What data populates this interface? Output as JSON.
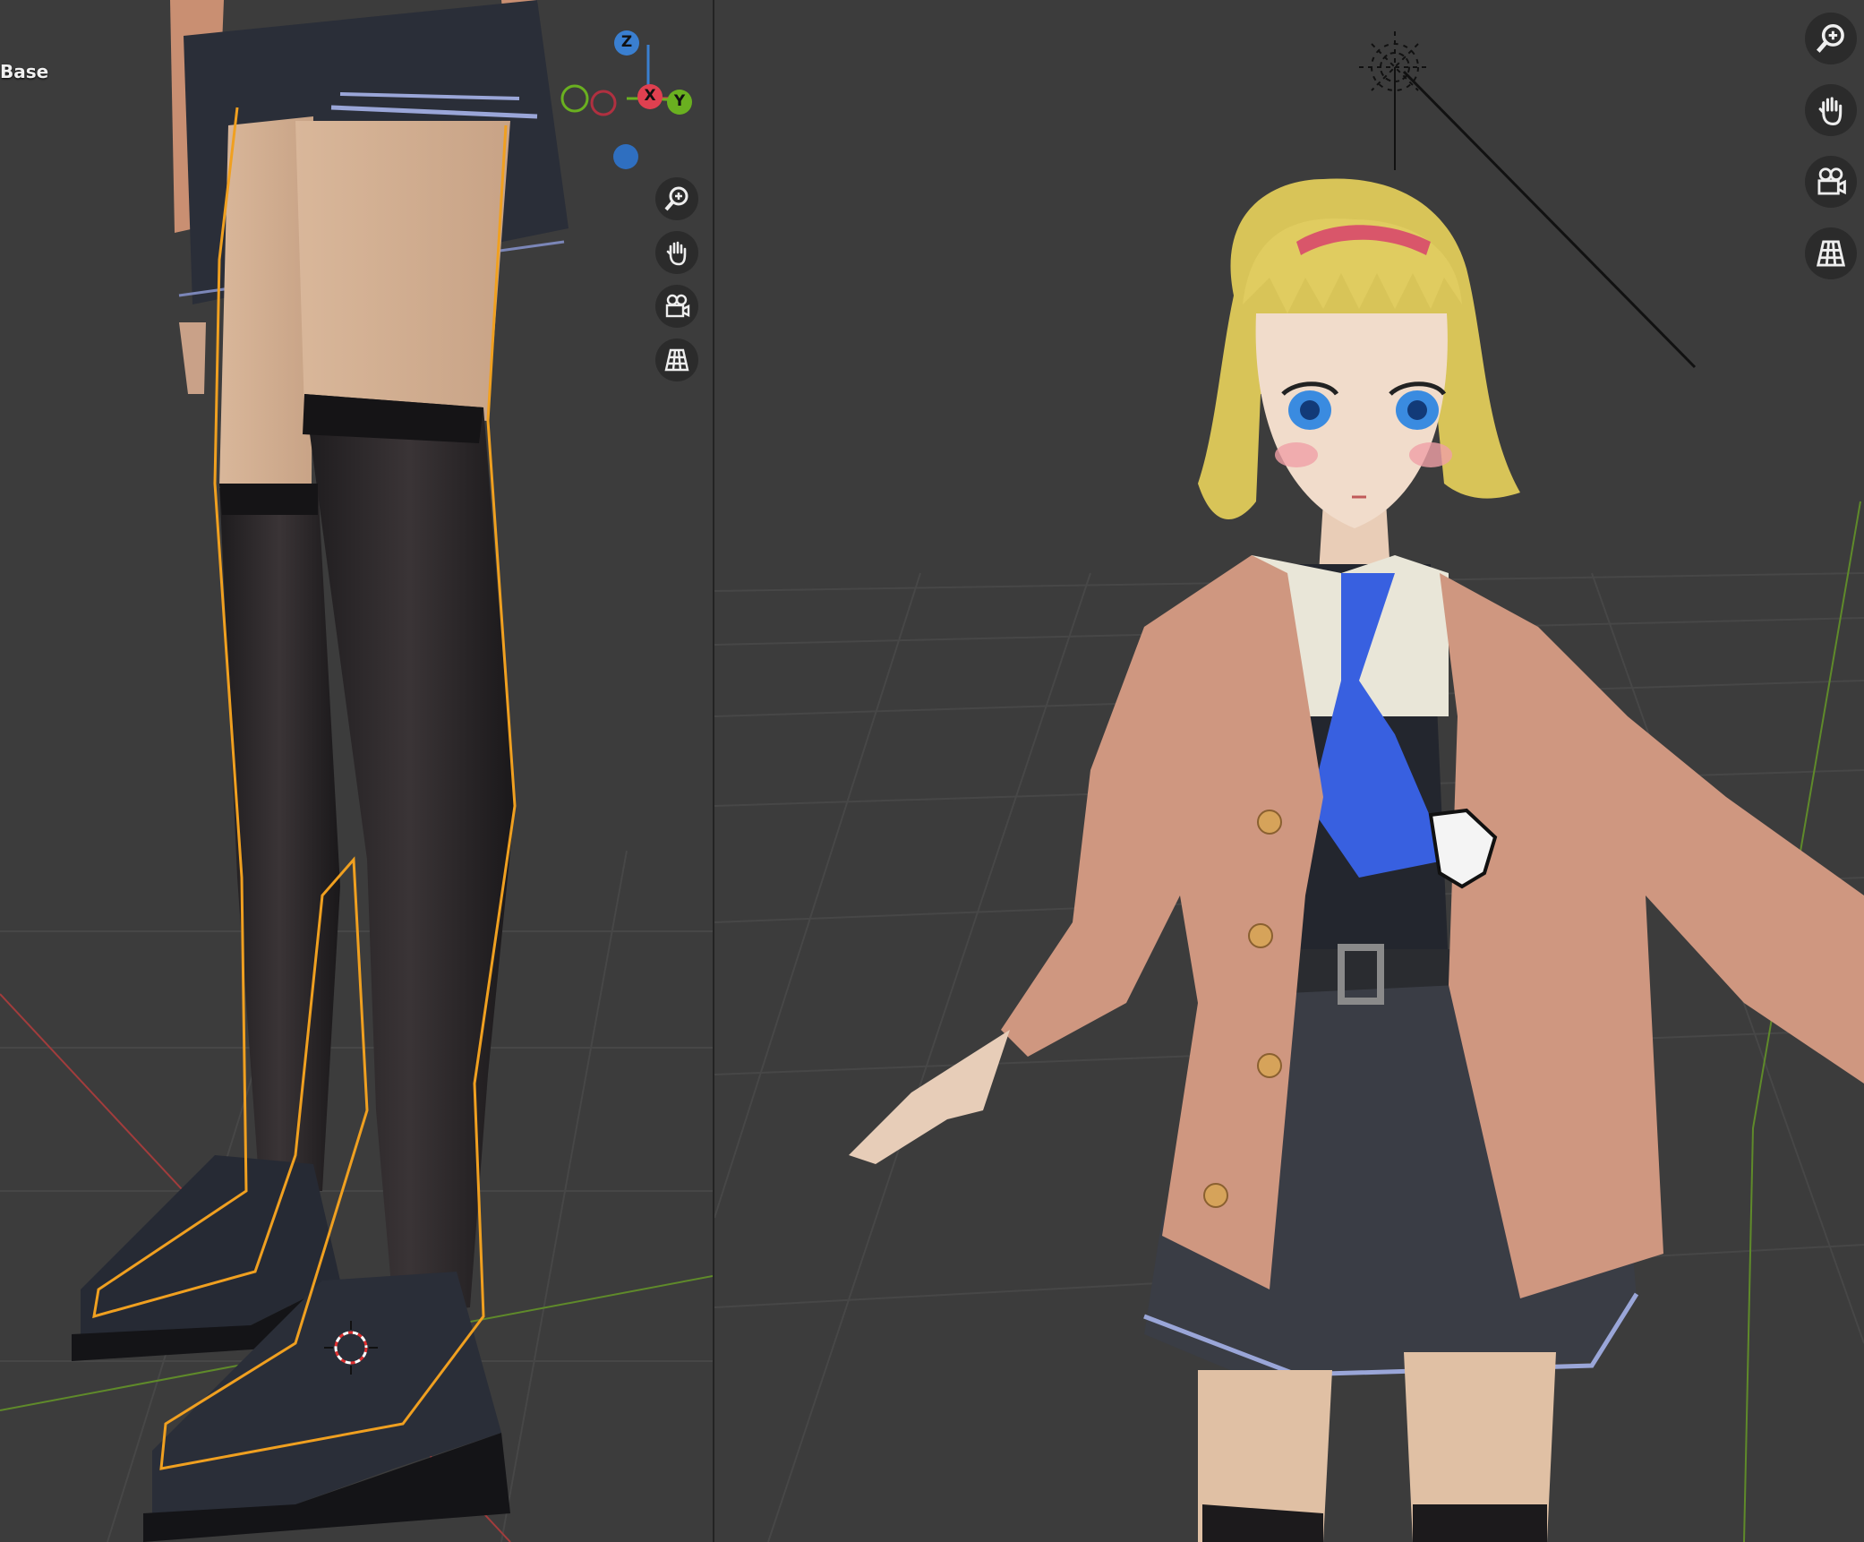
{
  "left_viewport": {
    "object_label": "Base",
    "gizmo": {
      "z_label": "Z",
      "x_label": "X",
      "y_label": "Y"
    },
    "nav_icons": [
      "zoom-in-icon",
      "hand-pan-icon",
      "camera-icon",
      "grid-icon"
    ]
  },
  "right_viewport": {
    "nav_icons": [
      "zoom-in-icon",
      "hand-pan-icon",
      "camera-icon",
      "grid-icon"
    ]
  },
  "colors": {
    "viewport_bg": "#3c3c3c",
    "grid_line": "#4a4a4a",
    "x_axis": "#b03a3a",
    "y_axis": "#6a9a2a",
    "gizmo_z": "#3a7fd0",
    "gizmo_x": "#e04050",
    "gizmo_y": "#6ab020",
    "selection_outline": "#f0a020"
  }
}
